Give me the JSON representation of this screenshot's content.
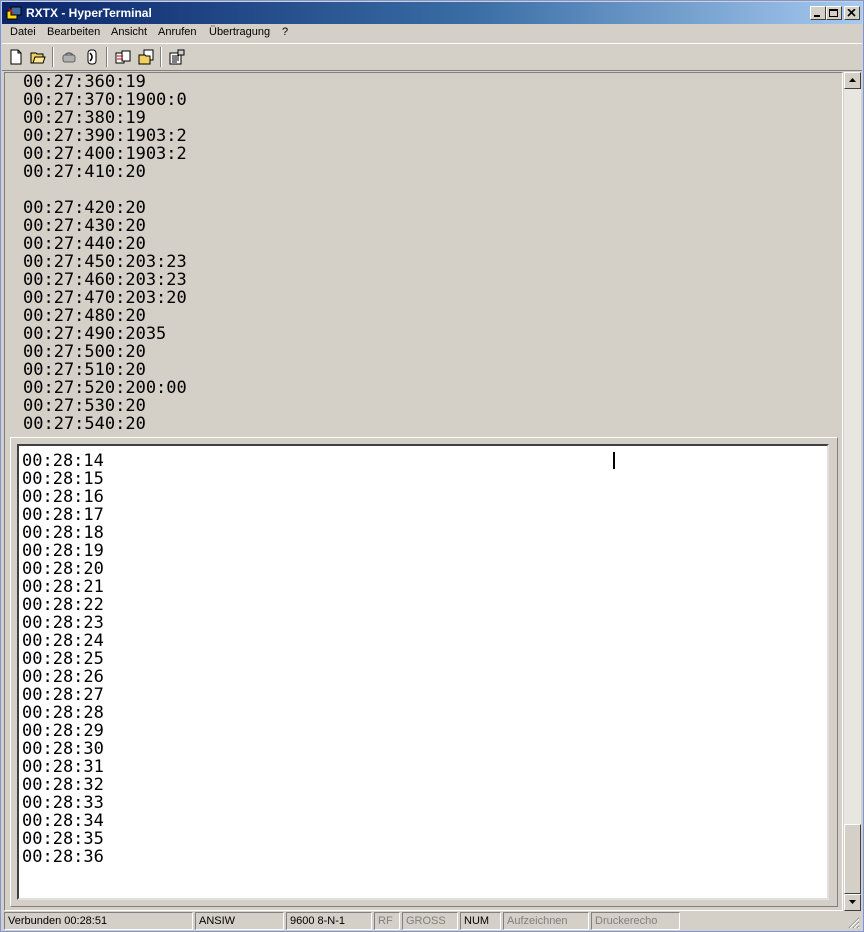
{
  "window": {
    "title": "RXTX - HyperTerminal",
    "icons": {
      "app": "hyperterminal-icon",
      "minimize": "minimize-icon",
      "maximize": "maximize-icon",
      "close": "close-icon"
    }
  },
  "menu": {
    "items": [
      "Datei",
      "Bearbeiten",
      "Ansicht",
      "Anrufen",
      "Übertragung",
      "?"
    ]
  },
  "toolbar": {
    "icons": [
      "new-icon",
      "open-icon",
      "call-icon",
      "disconnect-icon",
      "send-icon",
      "receive-icon",
      "properties-icon"
    ]
  },
  "scrollback": {
    "lines": [
      "00:27:360:19",
      "00:27:370:1900:0",
      "00:27:380:19",
      "00:27:390:1903:2",
      "00:27:400:1903:2",
      "00:27:410:20",
      "",
      "00:27:420:20",
      "00:27:430:20",
      "00:27:440:20",
      "00:27:450:203:23",
      "00:27:460:203:23",
      "00:27:470:203:20",
      "00:27:480:20",
      "00:27:490:2035",
      "00:27:500:20",
      "00:27:510:20",
      "00:27:520:200:00",
      "00:27:530:20",
      "00:27:540:20"
    ]
  },
  "screen": {
    "lines": [
      "00:28:14",
      "00:28:15",
      "00:28:16",
      "00:28:17",
      "00:28:18",
      "00:28:19",
      "00:28:20",
      "00:28:21",
      "00:28:22",
      "00:28:23",
      "00:28:24",
      "00:28:25",
      "00:28:26",
      "00:28:27",
      "00:28:28",
      "00:28:29",
      "00:28:30",
      "00:28:31",
      "00:28:32",
      "00:28:33",
      "00:28:34",
      "00:28:35",
      "00:28:36"
    ]
  },
  "status": {
    "connection": "Verbunden 00:28:51",
    "emulation": "ANSIW",
    "port_settings": "9600 8-N-1",
    "rf": "RF",
    "caps": "GROSS",
    "num": "NUM",
    "capture": "Aufzeichnen",
    "print_echo": "Druckerecho"
  }
}
